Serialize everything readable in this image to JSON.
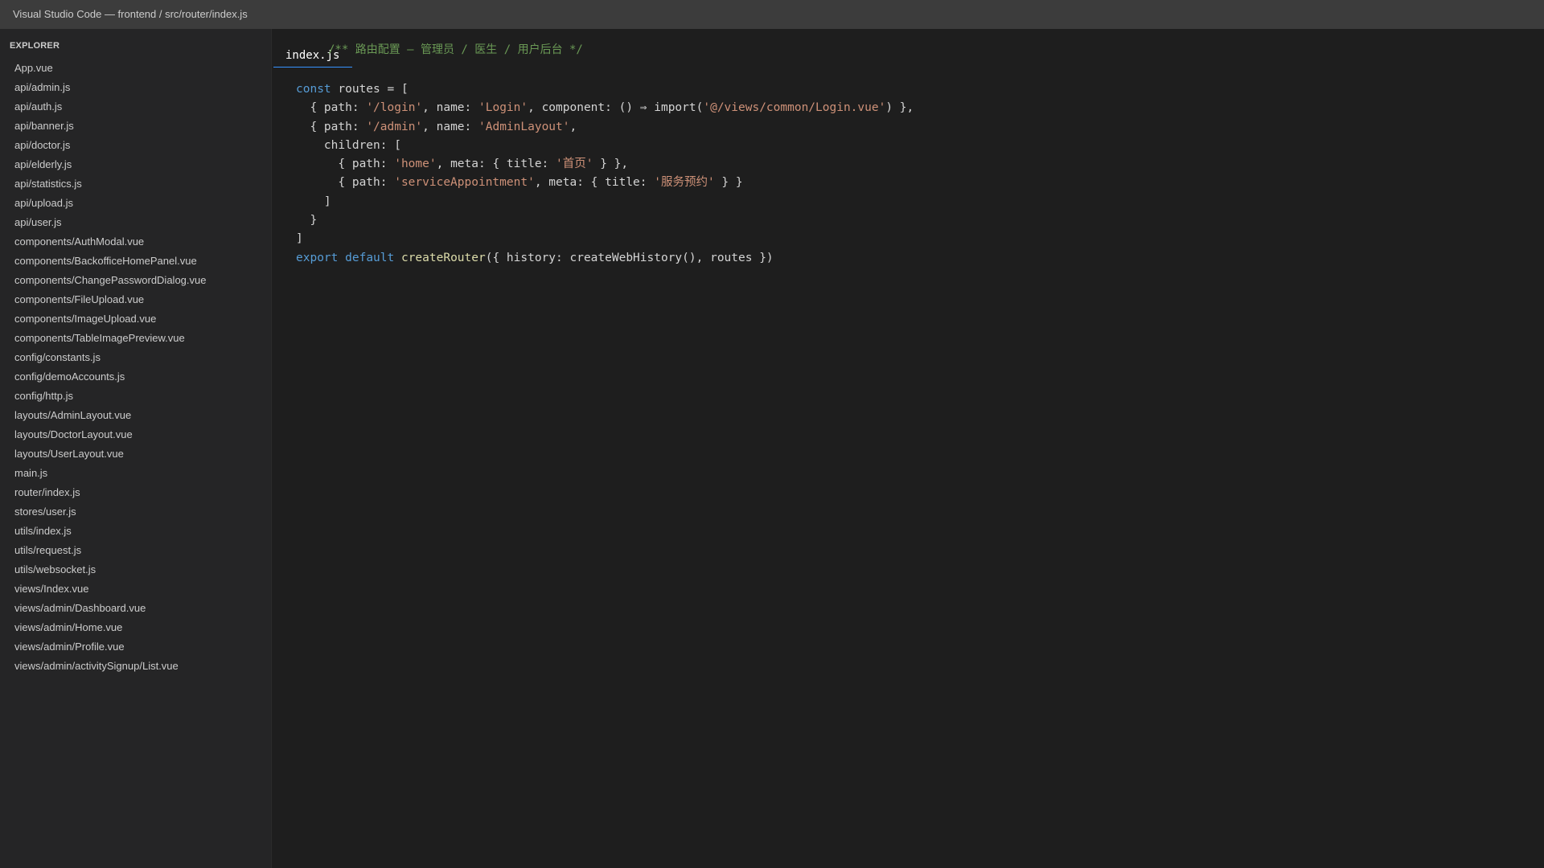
{
  "window": {
    "title": "Visual Studio Code — frontend / src/router/index.js"
  },
  "sidebar": {
    "header": "EXPLORER",
    "files": [
      "App.vue",
      "api/admin.js",
      "api/auth.js",
      "api/banner.js",
      "api/doctor.js",
      "api/elderly.js",
      "api/statistics.js",
      "api/upload.js",
      "api/user.js",
      "components/AuthModal.vue",
      "components/BackofficeHomePanel.vue",
      "components/ChangePasswordDialog.vue",
      "components/FileUpload.vue",
      "components/ImageUpload.vue",
      "components/TableImagePreview.vue",
      "config/constants.js",
      "config/demoAccounts.js",
      "config/http.js",
      "layouts/AdminLayout.vue",
      "layouts/DoctorLayout.vue",
      "layouts/UserLayout.vue",
      "main.js",
      "router/index.js",
      "stores/user.js",
      "utils/index.js",
      "utils/request.js",
      "utils/websocket.js",
      "views/Index.vue",
      "views/admin/Dashboard.vue",
      "views/admin/Home.vue",
      "views/admin/Profile.vue",
      "views/admin/activitySignup/List.vue"
    ]
  },
  "editor": {
    "tab_label": "index.js",
    "header_comment": "/** 路由配置 — 管理员 / 医生 / 用户后台 */",
    "syntax_colors": {
      "keyword": "#569cd6",
      "string": "#ce9178",
      "function": "#dcdcaa",
      "comment": "#6a9955",
      "text": "#d4d4d4"
    },
    "code_lines": [
      [
        [
          "kw",
          "const"
        ],
        [
          "plain",
          " routes = ["
        ]
      ],
      [
        [
          "plain",
          "  { path: "
        ],
        [
          "str",
          "'/login'"
        ],
        [
          "plain",
          ", name: "
        ],
        [
          "str",
          "'Login'"
        ],
        [
          "plain",
          ", component: () ⇒ import("
        ],
        [
          "str",
          "'@/views/common/Login.vue'"
        ],
        [
          "plain",
          ") },"
        ]
      ],
      [
        [
          "plain",
          "  { path: "
        ],
        [
          "str",
          "'/admin'"
        ],
        [
          "plain",
          ", name: "
        ],
        [
          "str",
          "'AdminLayout'"
        ],
        [
          "plain",
          ","
        ]
      ],
      [
        [
          "plain",
          "    children: ["
        ]
      ],
      [
        [
          "plain",
          "      { path: "
        ],
        [
          "str",
          "'home'"
        ],
        [
          "plain",
          ", meta: { title: "
        ],
        [
          "str",
          "'首页'"
        ],
        [
          "plain",
          " } },"
        ]
      ],
      [
        [
          "plain",
          "      { path: "
        ],
        [
          "str",
          "'serviceAppointment'"
        ],
        [
          "plain",
          ", meta: { title: "
        ],
        [
          "str",
          "'服务预约'"
        ],
        [
          "plain",
          " } }"
        ]
      ],
      [
        [
          "plain",
          "    ]"
        ]
      ],
      [
        [
          "plain",
          "  }"
        ]
      ],
      [
        [
          "plain",
          "]"
        ]
      ],
      [
        [
          "kw",
          "export"
        ],
        [
          "plain",
          " "
        ],
        [
          "kw",
          "default"
        ],
        [
          "plain",
          " "
        ],
        [
          "fn",
          "createRouter"
        ],
        [
          "plain",
          "({ history: createWebHistory(), routes })"
        ]
      ]
    ]
  }
}
